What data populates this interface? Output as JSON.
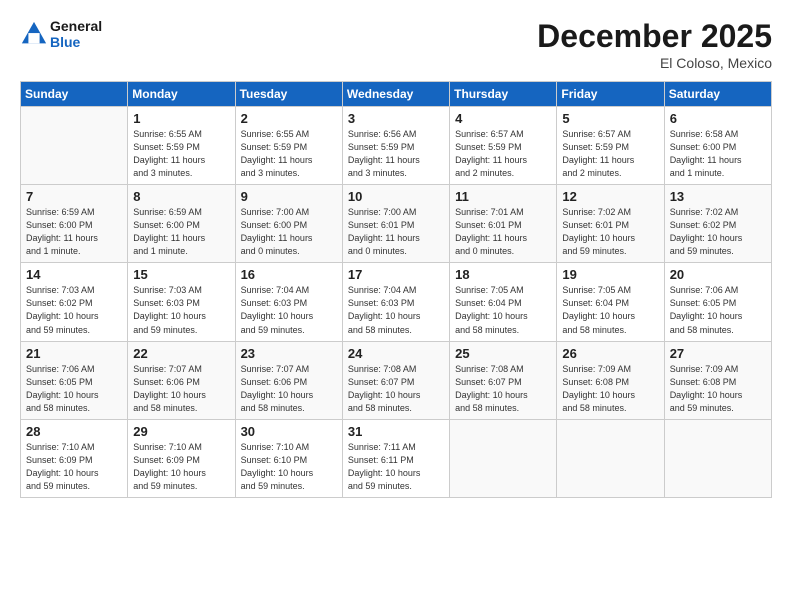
{
  "header": {
    "logo_line1": "General",
    "logo_line2": "Blue",
    "month": "December 2025",
    "location": "El Coloso, Mexico"
  },
  "days_of_week": [
    "Sunday",
    "Monday",
    "Tuesday",
    "Wednesday",
    "Thursday",
    "Friday",
    "Saturday"
  ],
  "weeks": [
    [
      {
        "num": "",
        "info": ""
      },
      {
        "num": "1",
        "info": "Sunrise: 6:55 AM\nSunset: 5:59 PM\nDaylight: 11 hours\nand 3 minutes."
      },
      {
        "num": "2",
        "info": "Sunrise: 6:55 AM\nSunset: 5:59 PM\nDaylight: 11 hours\nand 3 minutes."
      },
      {
        "num": "3",
        "info": "Sunrise: 6:56 AM\nSunset: 5:59 PM\nDaylight: 11 hours\nand 3 minutes."
      },
      {
        "num": "4",
        "info": "Sunrise: 6:57 AM\nSunset: 5:59 PM\nDaylight: 11 hours\nand 2 minutes."
      },
      {
        "num": "5",
        "info": "Sunrise: 6:57 AM\nSunset: 5:59 PM\nDaylight: 11 hours\nand 2 minutes."
      },
      {
        "num": "6",
        "info": "Sunrise: 6:58 AM\nSunset: 6:00 PM\nDaylight: 11 hours\nand 1 minute."
      }
    ],
    [
      {
        "num": "7",
        "info": "Sunrise: 6:59 AM\nSunset: 6:00 PM\nDaylight: 11 hours\nand 1 minute."
      },
      {
        "num": "8",
        "info": "Sunrise: 6:59 AM\nSunset: 6:00 PM\nDaylight: 11 hours\nand 1 minute."
      },
      {
        "num": "9",
        "info": "Sunrise: 7:00 AM\nSunset: 6:00 PM\nDaylight: 11 hours\nand 0 minutes."
      },
      {
        "num": "10",
        "info": "Sunrise: 7:00 AM\nSunset: 6:01 PM\nDaylight: 11 hours\nand 0 minutes."
      },
      {
        "num": "11",
        "info": "Sunrise: 7:01 AM\nSunset: 6:01 PM\nDaylight: 11 hours\nand 0 minutes."
      },
      {
        "num": "12",
        "info": "Sunrise: 7:02 AM\nSunset: 6:01 PM\nDaylight: 10 hours\nand 59 minutes."
      },
      {
        "num": "13",
        "info": "Sunrise: 7:02 AM\nSunset: 6:02 PM\nDaylight: 10 hours\nand 59 minutes."
      }
    ],
    [
      {
        "num": "14",
        "info": "Sunrise: 7:03 AM\nSunset: 6:02 PM\nDaylight: 10 hours\nand 59 minutes."
      },
      {
        "num": "15",
        "info": "Sunrise: 7:03 AM\nSunset: 6:03 PM\nDaylight: 10 hours\nand 59 minutes."
      },
      {
        "num": "16",
        "info": "Sunrise: 7:04 AM\nSunset: 6:03 PM\nDaylight: 10 hours\nand 59 minutes."
      },
      {
        "num": "17",
        "info": "Sunrise: 7:04 AM\nSunset: 6:03 PM\nDaylight: 10 hours\nand 58 minutes."
      },
      {
        "num": "18",
        "info": "Sunrise: 7:05 AM\nSunset: 6:04 PM\nDaylight: 10 hours\nand 58 minutes."
      },
      {
        "num": "19",
        "info": "Sunrise: 7:05 AM\nSunset: 6:04 PM\nDaylight: 10 hours\nand 58 minutes."
      },
      {
        "num": "20",
        "info": "Sunrise: 7:06 AM\nSunset: 6:05 PM\nDaylight: 10 hours\nand 58 minutes."
      }
    ],
    [
      {
        "num": "21",
        "info": "Sunrise: 7:06 AM\nSunset: 6:05 PM\nDaylight: 10 hours\nand 58 minutes."
      },
      {
        "num": "22",
        "info": "Sunrise: 7:07 AM\nSunset: 6:06 PM\nDaylight: 10 hours\nand 58 minutes."
      },
      {
        "num": "23",
        "info": "Sunrise: 7:07 AM\nSunset: 6:06 PM\nDaylight: 10 hours\nand 58 minutes."
      },
      {
        "num": "24",
        "info": "Sunrise: 7:08 AM\nSunset: 6:07 PM\nDaylight: 10 hours\nand 58 minutes."
      },
      {
        "num": "25",
        "info": "Sunrise: 7:08 AM\nSunset: 6:07 PM\nDaylight: 10 hours\nand 58 minutes."
      },
      {
        "num": "26",
        "info": "Sunrise: 7:09 AM\nSunset: 6:08 PM\nDaylight: 10 hours\nand 58 minutes."
      },
      {
        "num": "27",
        "info": "Sunrise: 7:09 AM\nSunset: 6:08 PM\nDaylight: 10 hours\nand 59 minutes."
      }
    ],
    [
      {
        "num": "28",
        "info": "Sunrise: 7:10 AM\nSunset: 6:09 PM\nDaylight: 10 hours\nand 59 minutes."
      },
      {
        "num": "29",
        "info": "Sunrise: 7:10 AM\nSunset: 6:09 PM\nDaylight: 10 hours\nand 59 minutes."
      },
      {
        "num": "30",
        "info": "Sunrise: 7:10 AM\nSunset: 6:10 PM\nDaylight: 10 hours\nand 59 minutes."
      },
      {
        "num": "31",
        "info": "Sunrise: 7:11 AM\nSunset: 6:11 PM\nDaylight: 10 hours\nand 59 minutes."
      },
      {
        "num": "",
        "info": ""
      },
      {
        "num": "",
        "info": ""
      },
      {
        "num": "",
        "info": ""
      }
    ]
  ]
}
